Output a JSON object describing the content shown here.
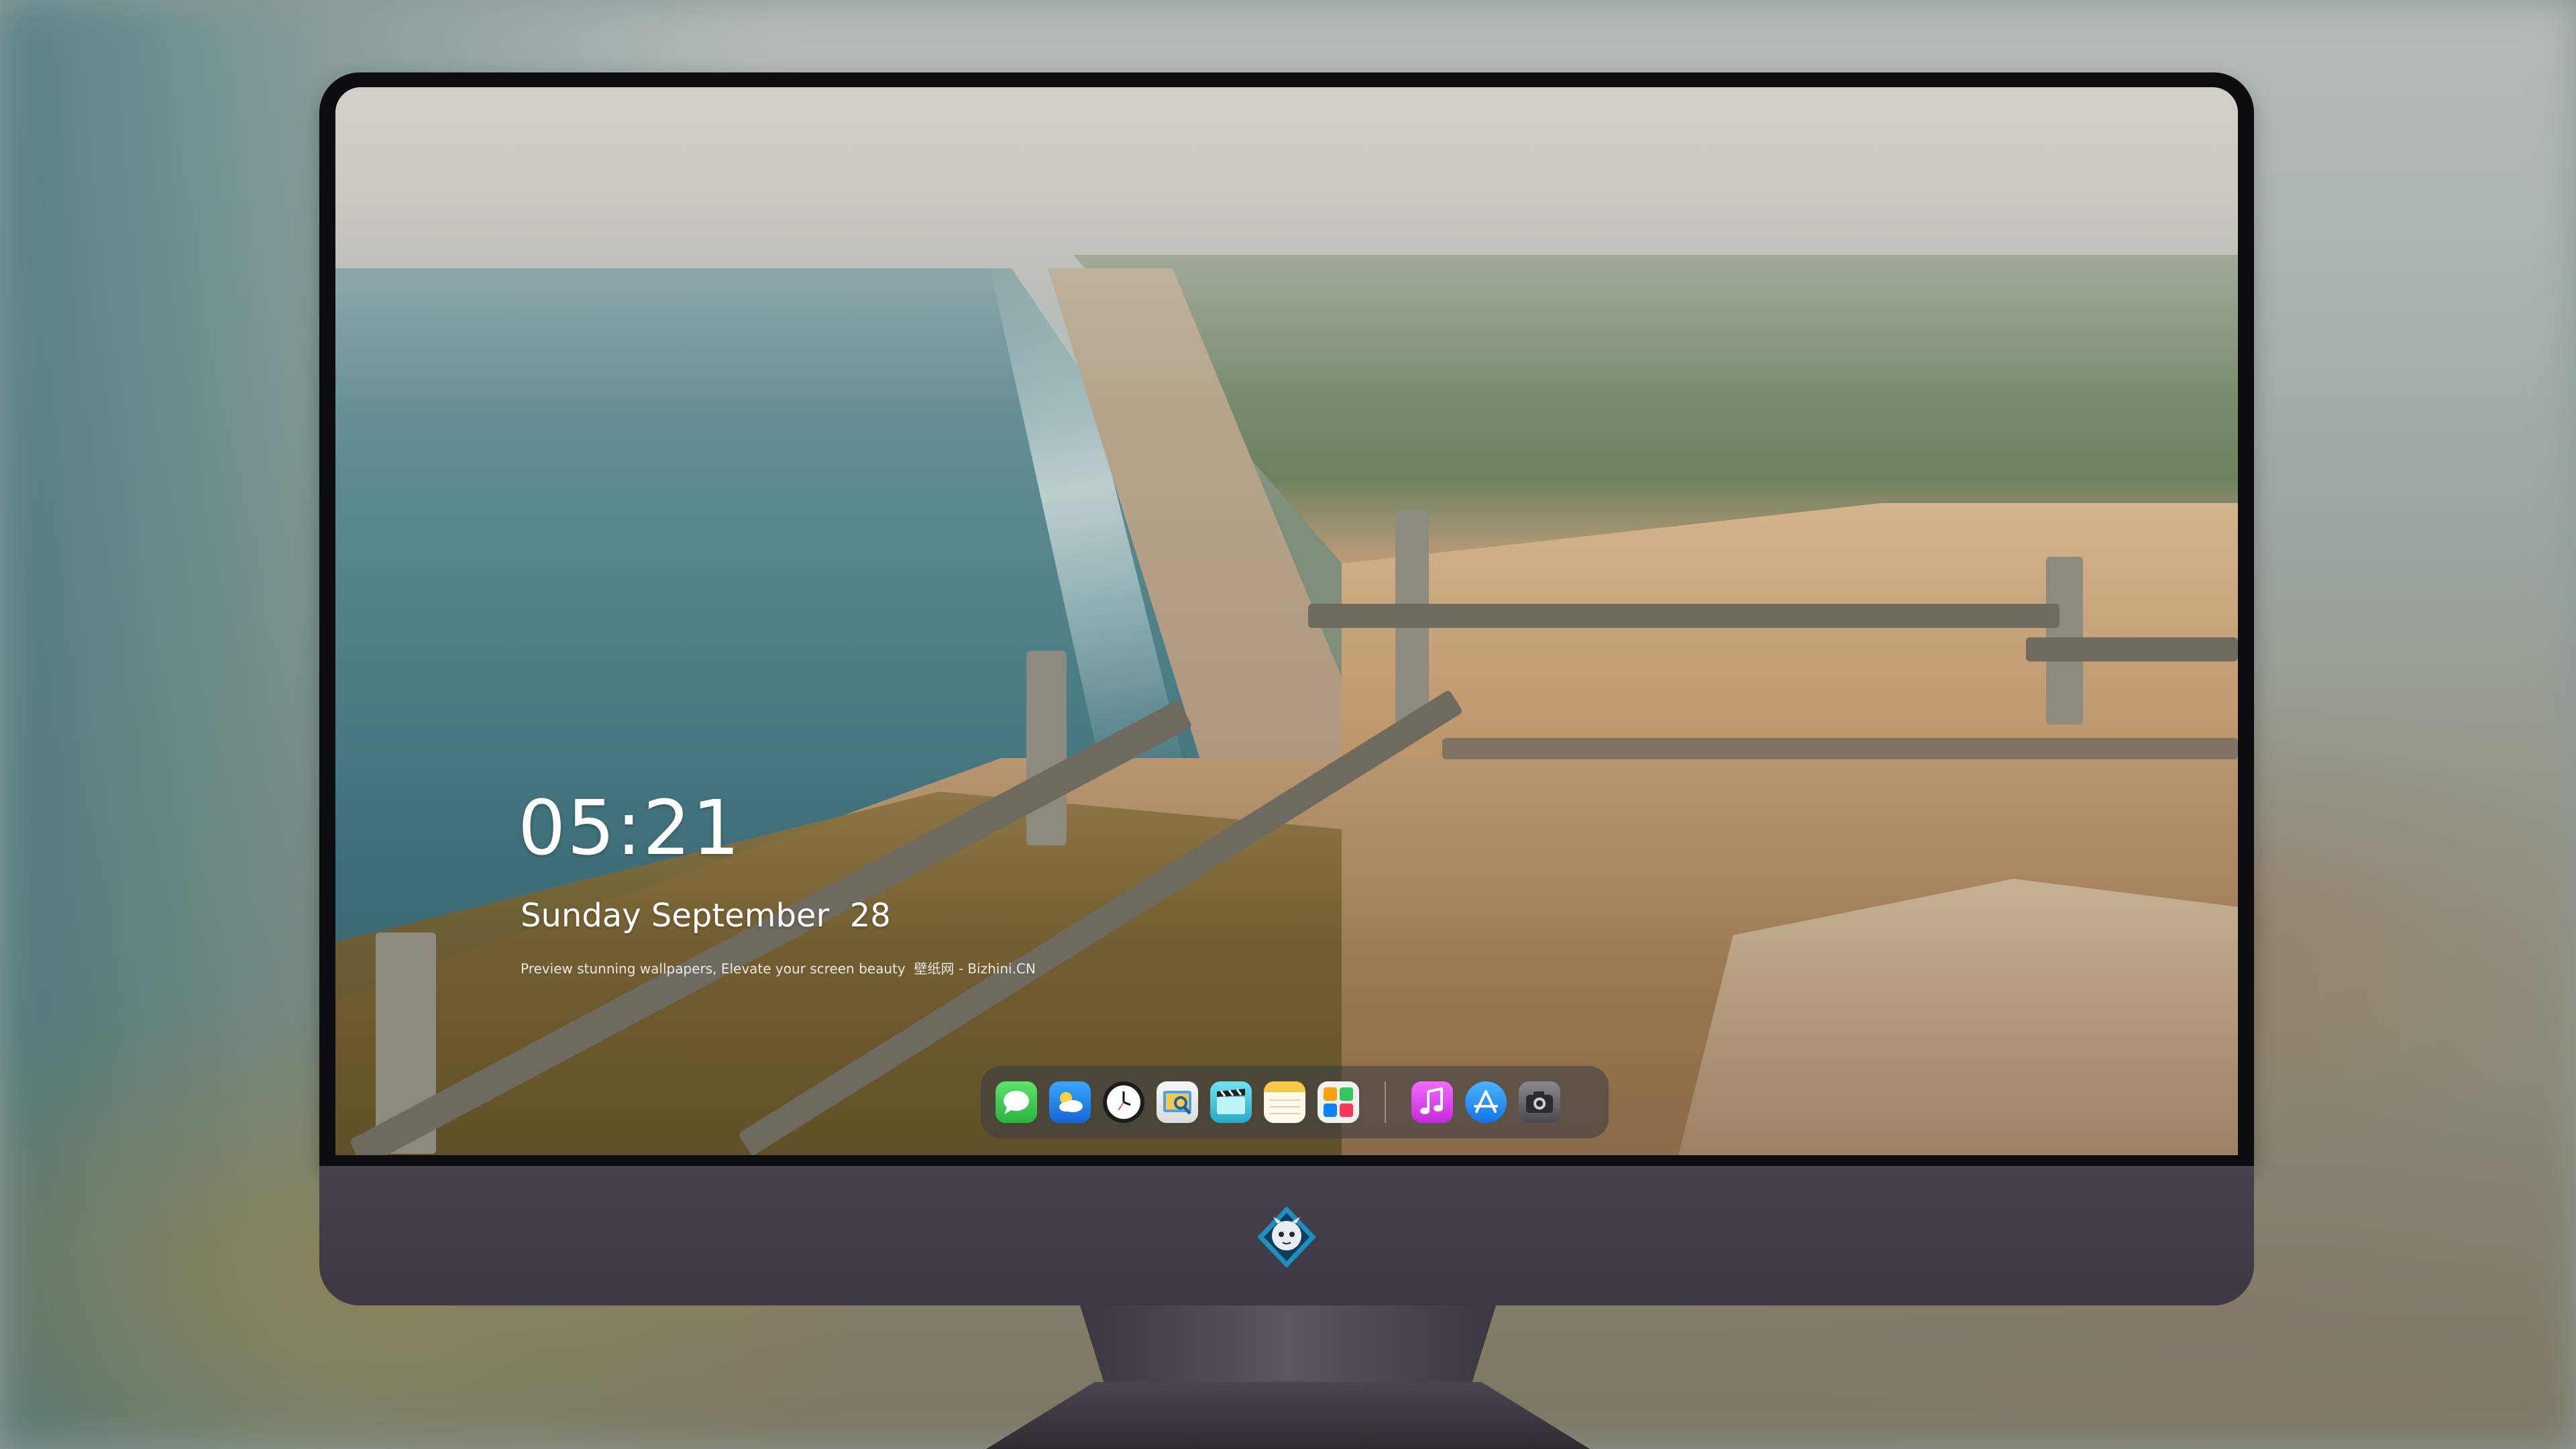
{
  "lock_screen": {
    "time": "05:21",
    "date": "Sunday September  28",
    "tagline": "Preview stunning wallpapers, Elevate your screen beauty  壁纸网 - Bizhini.CN"
  },
  "dock": {
    "apps": [
      {
        "name": "messages-icon",
        "color": "#34c759"
      },
      {
        "name": "weather-icon",
        "color": "#1f8ef1"
      },
      {
        "name": "clock-icon",
        "color": "#1c1c1e"
      },
      {
        "name": "preview-icon",
        "color": "#f2c94c"
      },
      {
        "name": "final-cut-icon",
        "color": "#3ec6d8"
      },
      {
        "name": "notes-icon",
        "color": "#f7d34a"
      },
      {
        "name": "photos-folder-icon",
        "color": "#ffffff"
      },
      {
        "name": "music-icon",
        "color": "#e84fdd"
      },
      {
        "name": "app-store-icon",
        "color": "#1e8cf5"
      },
      {
        "name": "camera-icon",
        "color": "#5a5a5e"
      }
    ]
  },
  "monitor": {
    "logo": "mascot-logo-icon",
    "accent": "#3d3944"
  }
}
